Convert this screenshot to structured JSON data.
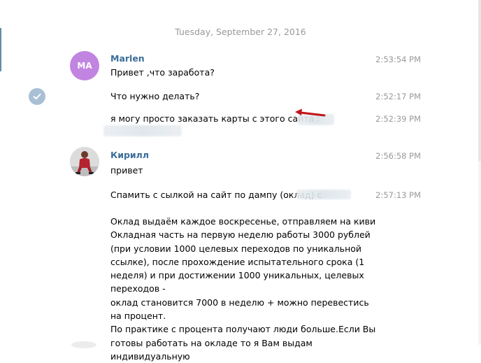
{
  "date_separator": "Tuesday, September 27, 2016",
  "messages": [
    {
      "sender": "Marlen",
      "avatar_initials": "MA",
      "avatar_color": "#c184e1",
      "items": [
        {
          "text": "Привет ,что заработа?",
          "time": "2:53:54 PM"
        },
        {
          "text": "Что нужно делать?",
          "time": "2:52:17 PM"
        },
        {
          "text": "я могу просто заказать карты с этого сайта :",
          "time": "2:52:39 PM"
        }
      ]
    },
    {
      "sender": "Кирилл",
      "items": [
        {
          "text": "привет",
          "time": "2:56:58 PM"
        },
        {
          "text": "Спамить с сылкой на сайт по дампу (оклад) c",
          "time": "2:57:13 PM"
        },
        {
          "text": "Оклад выдаём каждое воскресенье, отправляем на киви\nОкладная часть на первую неделю работы 3000 рублей (при условии 1000 целевых переходов по уникальной ссылке), после прохождение испытательного срока (1 неделя) и при достижении 1000 уникальных, целевых переходов -\nоклад становится 7000 в неделю + можно перевестись на процент.\nПо практике с процента получают люди больше.Если Вы готовы работать на окладе то я Вам выдам индивидуальную"
        }
      ]
    }
  ],
  "colors": {
    "sender": "#3a6d99",
    "time": "#999999",
    "arrow": "#c0151b",
    "read_check": "#a8bfd4"
  },
  "icons": {
    "read_status": "check-circle-icon",
    "annotation": "red-arrow-icon"
  }
}
